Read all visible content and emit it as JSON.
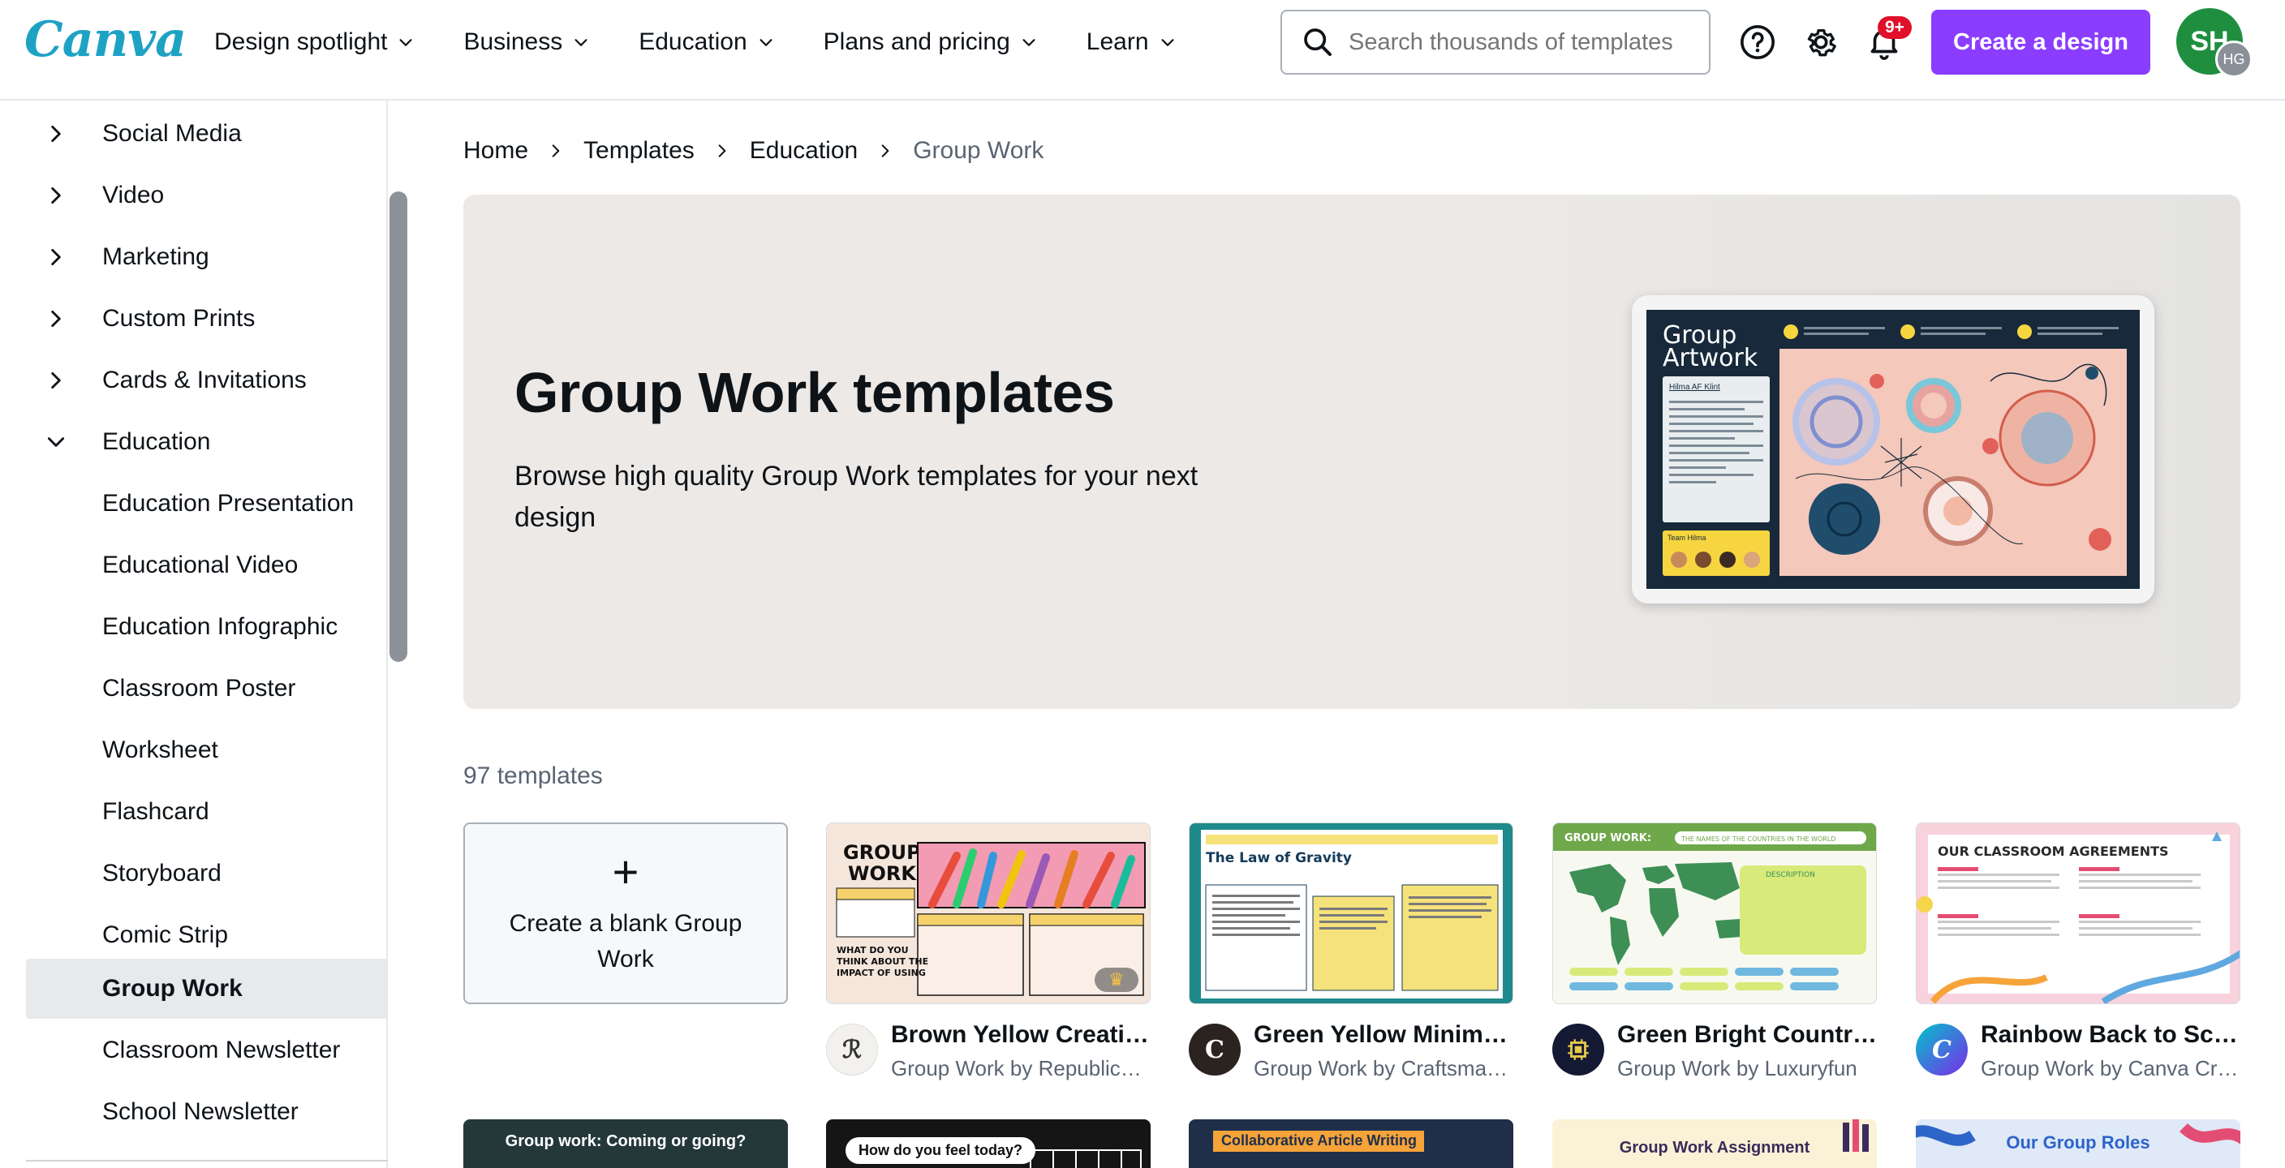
{
  "topbar": {
    "logo": "Canva",
    "nav": [
      "Design spotlight",
      "Business",
      "Education",
      "Plans and pricing",
      "Learn"
    ],
    "search_placeholder": "Search thousands of templates",
    "notification_badge": "9+",
    "create_button": "Create a design",
    "avatar_initials": "SH",
    "avatar_sub_initials": "HG"
  },
  "sidebar": {
    "items": [
      {
        "label": "Social Media",
        "arrow": "right"
      },
      {
        "label": "Video",
        "arrow": "right"
      },
      {
        "label": "Marketing",
        "arrow": "right"
      },
      {
        "label": "Custom Prints",
        "arrow": "right"
      },
      {
        "label": "Cards & Invitations",
        "arrow": "right"
      },
      {
        "label": "Education",
        "arrow": "down"
      },
      {
        "label": "Education Presentation"
      },
      {
        "label": "Educational Video"
      },
      {
        "label": "Education Infographic"
      },
      {
        "label": "Classroom Poster"
      },
      {
        "label": "Worksheet"
      },
      {
        "label": "Flashcard"
      },
      {
        "label": "Storyboard"
      },
      {
        "label": "Comic Strip"
      },
      {
        "label": "Group Work",
        "active": true
      },
      {
        "label": "Classroom Newsletter"
      },
      {
        "label": "School Newsletter"
      }
    ]
  },
  "breadcrumb": [
    "Home",
    "Templates",
    "Education",
    "Group Work"
  ],
  "hero": {
    "title": "Group Work templates",
    "subtitle": "Browse high quality Group Work templates for your next design",
    "preview": {
      "title": "Group Artwork",
      "card_heading": "Hilma AF Klint",
      "team_label": "Team Hilma"
    }
  },
  "count": "97 templates",
  "blank_card": "Create a blank Group Work",
  "cards": [
    {
      "title": "Brown Yellow Creative Group Work",
      "subtitle": "Group Work by RepublicDesign",
      "thumb_text": "GROUP WORK",
      "avatar_color": "#f3f1ee",
      "premium": true
    },
    {
      "title": "Green Yellow Minimalist Group Work",
      "subtitle": "Group Work by Craftsman Studio",
      "thumb_text": "The Law of Gravity",
      "avatar_color": "#2b2320"
    },
    {
      "title": "Green Bright Countries Group Work",
      "subtitle": "Group Work by Luxuryfun",
      "thumb_text": "GROUP WORK:",
      "thumb_text2": "THE NAMES OF THE COUNTRIES IN THE WORLD",
      "avatar_color": "#141a33"
    },
    {
      "title": "Rainbow Back to School Group Work",
      "subtitle": "Group Work by Canva Creative Studio",
      "thumb_text": "OUR CLASSROOM AGREEMENTS",
      "avatar_color": "#7c4dff"
    }
  ],
  "row2": [
    {
      "text": "Group work: Coming or going?",
      "bg": "#24383a",
      "color": "#ffffff"
    },
    {
      "text": "How do you feel today?",
      "bg": "#151515",
      "color": "#111111"
    },
    {
      "text": "Collaborative Article Writing",
      "bg": "#1f2f4a",
      "color": "#1f2f4a"
    },
    {
      "text": "Group Work Assignment",
      "bg": "#fbf1d6",
      "color": "#3a2b5a"
    },
    {
      "text": "Our Group Roles",
      "bg": "#dfe9f7",
      "color": "#2d64c8"
    }
  ]
}
